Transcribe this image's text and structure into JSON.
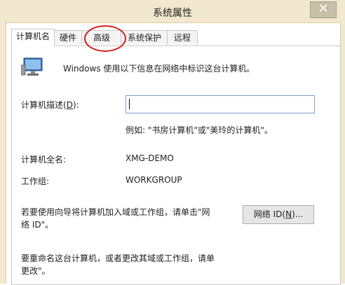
{
  "window": {
    "title": "系统属性",
    "close_glyph": "✕"
  },
  "tabs": [
    {
      "label": "计算机名",
      "active": true
    },
    {
      "label": "硬件",
      "active": false
    },
    {
      "label": "高级",
      "active": false,
      "highlighted": true
    },
    {
      "label": "系统保护",
      "active": false
    },
    {
      "label": "远程",
      "active": false
    }
  ],
  "intro_text": "Windows 使用以下信息在网络中标识这台计算机。",
  "description": {
    "label_prefix": "计算机描述(",
    "label_key": "D",
    "label_suffix": "):",
    "value": "",
    "example": "例如: \"书房计算机\"或\"美玲的计算机\"。"
  },
  "full_name": {
    "label": "计算机全名:",
    "value": "XMG-DEMO"
  },
  "workgroup": {
    "label": "工作组:",
    "value": "WORKGROUP"
  },
  "network_id": {
    "text_line1": "若要使用向导将计算机加入域或工作组，请单击\"网",
    "text_line2": "络 ID\"。",
    "button_prefix": "网络 ID(",
    "button_key": "N",
    "button_suffix": ")..."
  },
  "rename": {
    "text_line1": "要重命名这台计算机，或者更改其域或工作组，请单",
    "text_line2": "更改\"。"
  },
  "colors": {
    "annotation": "#d21e1e",
    "titlebar": "#f2e8cf",
    "input_border": "#7a9fc9"
  }
}
